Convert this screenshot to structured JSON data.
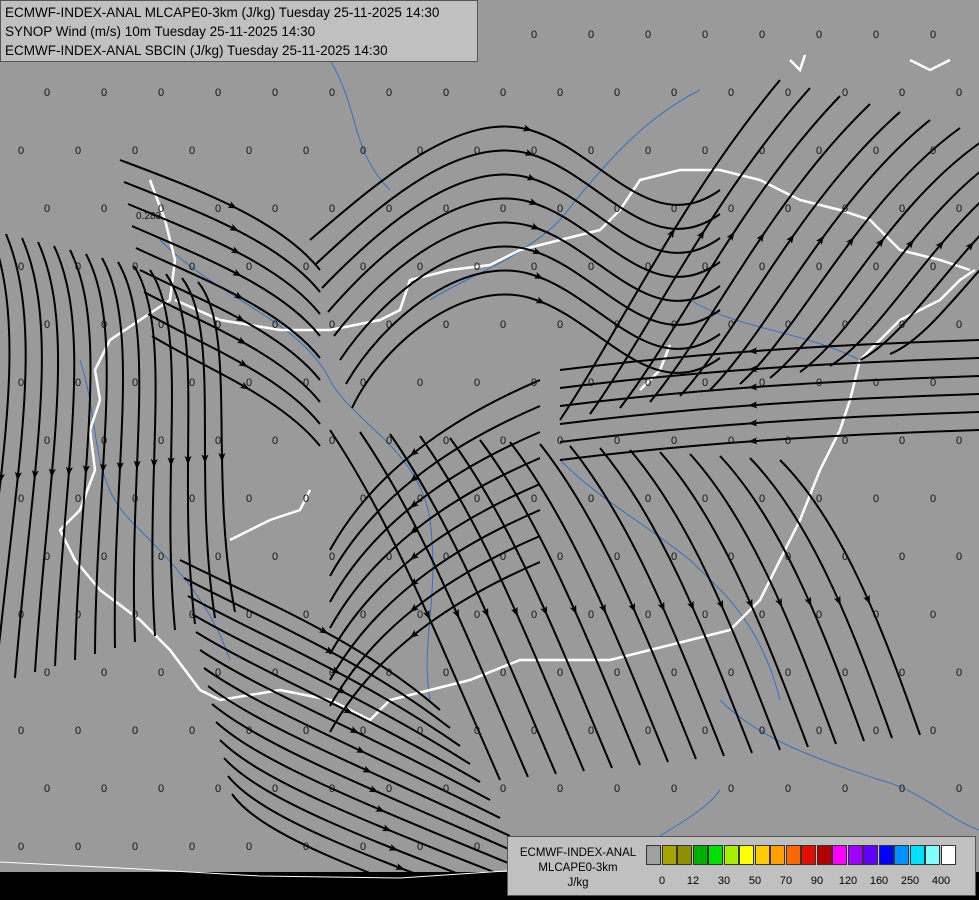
{
  "header": {
    "line1": "ECMWF-INDEX-ANAL MLCAPE0-3km (J/kg) Tuesday 25-11-2025 14:30",
    "line2": "SYNOP Wind (m/s) 10m Tuesday 25-11-2025 14:30",
    "line3": "ECMWF-INDEX-ANAL SBCIN (J/kg) Tuesday 25-11-2025 14:30"
  },
  "legend": {
    "title_line1": "ECMWF-INDEX-ANAL",
    "title_line2": "MLCAPE0-3km",
    "title_line3": "J/kg",
    "tick_labels": [
      "0",
      "12",
      "30",
      "50",
      "70",
      "90",
      "120",
      "160",
      "250",
      "400"
    ],
    "swatch_colors": [
      "#a0a0a0",
      "#a7a400",
      "#8f8f00",
      "#00b000",
      "#00e000",
      "#a8ee00",
      "#ffff00",
      "#ffcc00",
      "#ffa000",
      "#ff6600",
      "#e01000",
      "#b00000",
      "#ff00ff",
      "#a000ff",
      "#6000ff",
      "#0000ff",
      "#0090ff",
      "#00e0ff",
      "#80ffff",
      "#ffffff"
    ]
  },
  "map": {
    "field_value_label": "0",
    "station_value": "0.283",
    "colors": {
      "background": "#9a9a9a",
      "border": "#ffffff",
      "rivers": "#3a6fc0",
      "streamlines": "#000000",
      "bottom_band": "#000000"
    }
  }
}
